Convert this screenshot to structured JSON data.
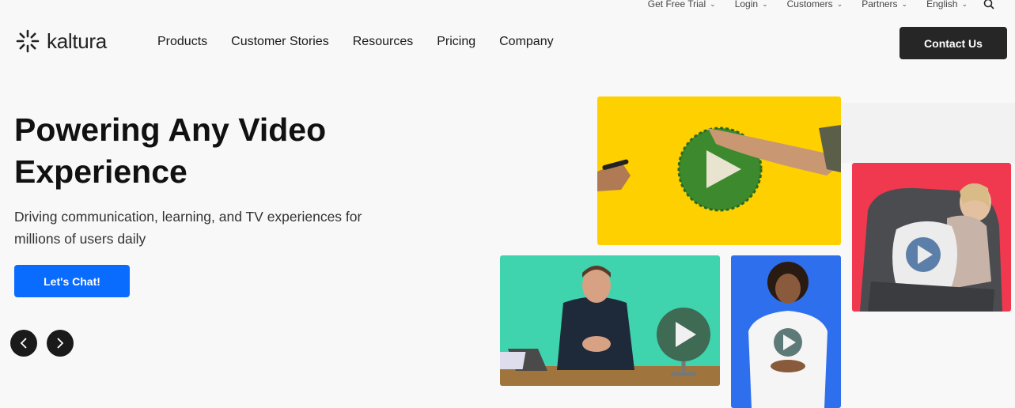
{
  "utility_nav": {
    "items": [
      "Get Free Trial",
      "Login",
      "Customers",
      "Partners",
      "English"
    ],
    "search_icon": "search-icon"
  },
  "brand": {
    "name": "kaltura"
  },
  "main_nav": {
    "items": [
      "Products",
      "Customer Stories",
      "Resources",
      "Pricing",
      "Company"
    ]
  },
  "header": {
    "contact_label": "Contact Us"
  },
  "hero": {
    "title": "Powering Any Video Experience",
    "subtitle": "Driving communication, learning, and TV experiences for millions of users daily",
    "cta_label": "Let's Chat!"
  },
  "carousel": {
    "prev_icon": "chevron-left-icon",
    "next_icon": "chevron-right-icon"
  },
  "colors": {
    "primary_blue": "#0a6cff",
    "dark": "#262626",
    "tile_yellow": "#ffd000",
    "tile_green": "#3fd4ad",
    "tile_blue": "#2e6fee",
    "tile_red": "#f0384f"
  }
}
